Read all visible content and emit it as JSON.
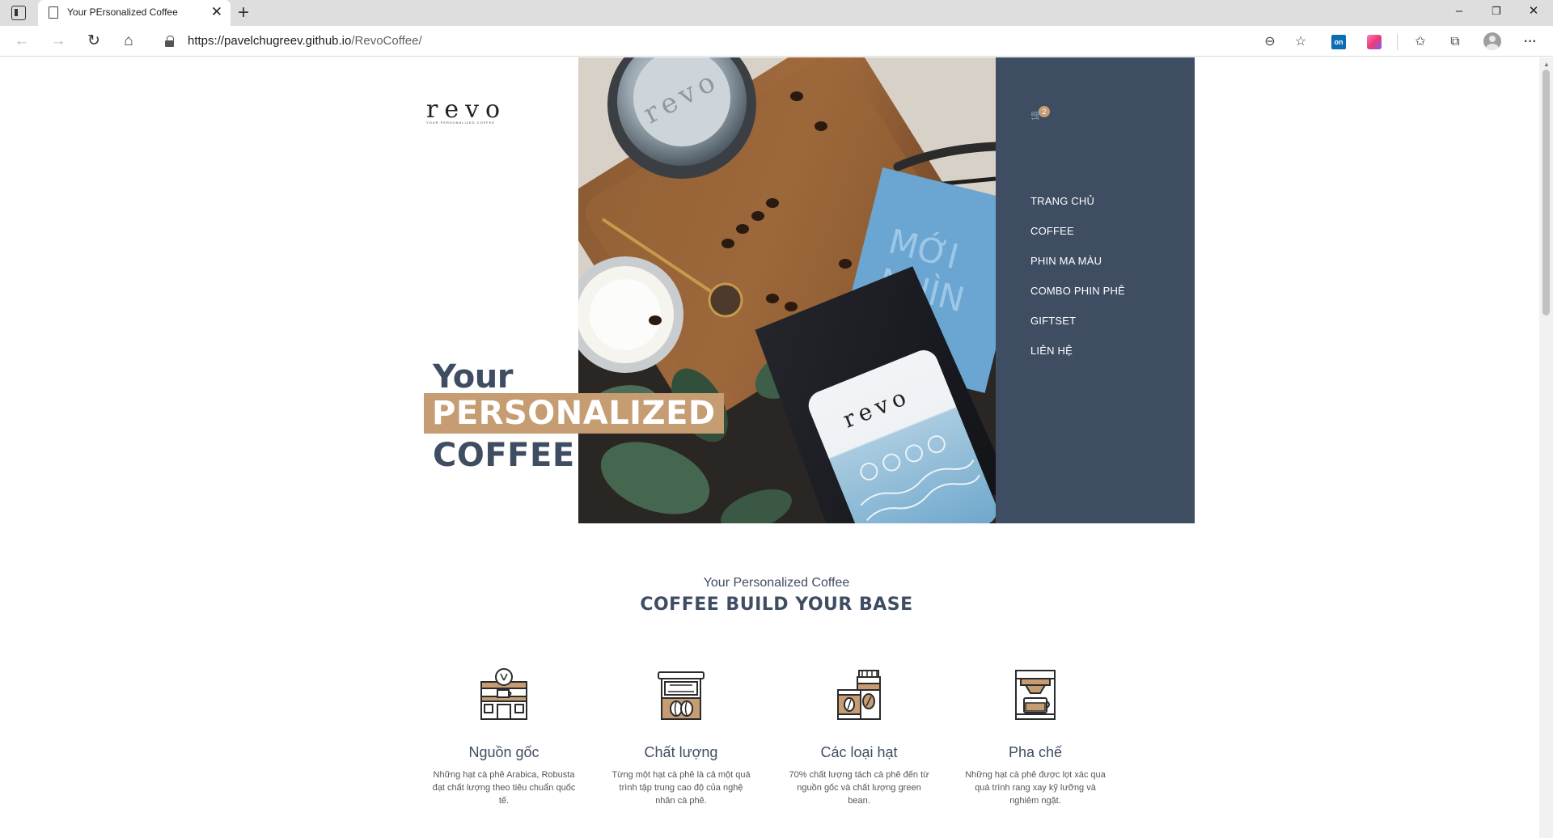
{
  "browser": {
    "tab_title": "Your PErsonalized Coffee",
    "url_host": "https://pavelchugreev.github.io",
    "url_path": "/RevoCoffee/",
    "extension_label": "on"
  },
  "brand": {
    "logo_text": "revo",
    "logo_tagline": "YOUR PERSONALIZED COFFEE"
  },
  "cart": {
    "count": "2"
  },
  "menu": [
    {
      "label": "TRANG CHỦ"
    },
    {
      "label": "COFFEE"
    },
    {
      "label": "PHIN MA MÀU"
    },
    {
      "label": "COMBO PHIN PHÊ"
    },
    {
      "label": "GIFTSET"
    },
    {
      "label": "LIÊN HỆ"
    }
  ],
  "hero": {
    "line1": "Your",
    "line2": "PERSONALIZED",
    "line3": "COFFEE",
    "package_brand": "revo",
    "card_text_1": "MỚI",
    "card_text_2": "NHÌN"
  },
  "section": {
    "subtitle": "Your Personalized Coffee",
    "title": "COFFEE BUILD YOUR BASE"
  },
  "features": [
    {
      "title": "Nguồn gốc",
      "desc": "Những hạt cà phê Arabica, Robusta đạt chất lượng theo tiêu chuẩn quốc tế.",
      "icon": "coffee-shop-icon"
    },
    {
      "title": "Chất lượng",
      "desc": "Từng một hạt cà phê là cả một quá trình tập trung cao độ của nghệ nhân cà phê.",
      "icon": "coffee-roaster-icon"
    },
    {
      "title": "Các loại hạt",
      "desc": "70% chất lượng tách cà phê đến từ nguồn gốc và chất lượng green bean.",
      "icon": "coffee-jars-icon"
    },
    {
      "title": "Pha chế",
      "desc": "Những hạt cà phê được lọt xác qua quá trình rang xay kỹ lưỡng và nghiêm ngặt.",
      "icon": "coffee-machine-icon"
    }
  ],
  "colors": {
    "navy": "#3f4d63",
    "tan": "#c69c72"
  }
}
